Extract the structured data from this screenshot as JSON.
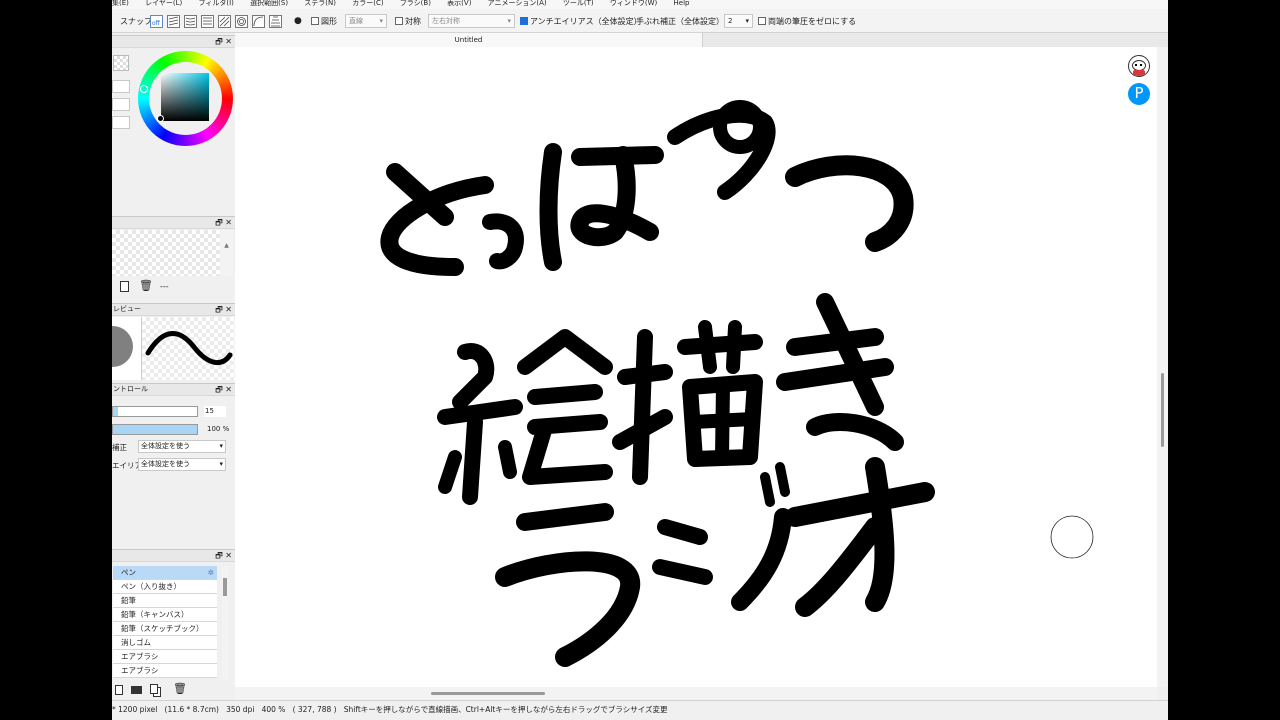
{
  "menu": [
    "集(E)",
    "レイヤー(L)",
    "フィルタ(I)",
    "選択範囲(S)",
    "ステラ(N)",
    "カラー(C)",
    "ブラシ(B)",
    "表示(V)",
    "アニメーション(A)",
    "ツール(T)",
    "ウィンドウ(W)",
    "Help"
  ],
  "toolbar": {
    "snap_label": "スナップ",
    "shape_label": "図形",
    "shape_value": "直線",
    "symmetry_label": "対称",
    "symmetry_value": "左右対称",
    "antialias_label": "アンチエイリアス（全体設定）",
    "stabilizer_label": "手ぶれ補正（全体設定）",
    "stabilizer_value": "2",
    "pressure_label": "両端の筆圧をゼロにする"
  },
  "colors": {
    "accent": "#1f6fd6",
    "selected_brush": "#b9d9f6",
    "pixiv_blue": "#0096fa"
  },
  "layer_panel": {
    "name_placeholder": "---"
  },
  "preview_panel": {
    "title": "レビュー"
  },
  "control_panel": {
    "title": "ントロール",
    "size_value": "15",
    "opacity_value": "100 %",
    "size_fill": 0.06,
    "opacity_fill": 1.0,
    "stabilizer_label": "補正",
    "stabilizer_value": "全体設定を使う",
    "antialias_label": "エイリア",
    "antialias_value": "全体設定を使う"
  },
  "brushes": [
    "ペン",
    "ペン（入り抜き）",
    "鉛筆",
    "鉛筆（キャンバス）",
    "鉛筆（スケッチブック）",
    "消しゴム",
    "エアブラシ",
    "エアブラシ"
  ],
  "document": {
    "tab_title": "Untitled"
  },
  "artwork": {
    "line1": "とっぱつ",
    "line2": "絵描き",
    "line3": "ラジオ"
  },
  "status": {
    "size": "* 1200 pixel",
    "physical": "(11.6 * 8.7cm)",
    "dpi": "350 dpi",
    "zoom": "400 %",
    "coords": "( 327, 788 )",
    "hint": "Shiftキーを押しながらで直線描画、Ctrl+Altキーを押しながら左右ドラッグでブラシサイズ変更"
  },
  "icons": [
    "snap-off-icon",
    "parallel-lines-icon",
    "grid-icon",
    "concentric-icon",
    "curve-icon",
    "radial-icon",
    "close-icon",
    "float-icon",
    "new-layer-icon",
    "trash-icon",
    "folder-icon",
    "copy-icon",
    "user-avatar-icon",
    "pixiv-icon"
  ]
}
